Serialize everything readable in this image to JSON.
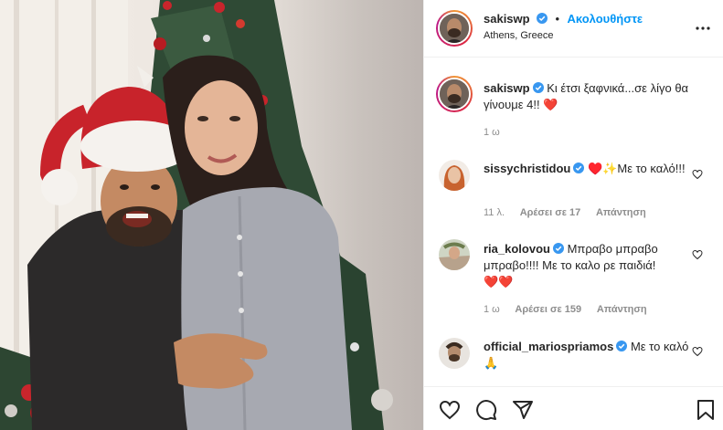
{
  "post": {
    "username": "sakiswp",
    "follow_label": "Ακολουθήστε",
    "separator": "•",
    "location": "Athens, Greece",
    "caption": "Κι έτσι ξαφνικά...σε λίγο θα γίνουμε 4!! ",
    "caption_emoji": "❤️",
    "time": "1 ω"
  },
  "comments": [
    {
      "username": "sissychristidou",
      "text": " ♥️✨Με το καλό!!!",
      "time": "11 λ.",
      "likes": "Αρέσει σε 17",
      "reply": "Απάντηση"
    },
    {
      "username": "ria_kolovou",
      "text": " Μπραβο μπραβο μπραβο!!!! Με το καλο ρε παιδιά!",
      "emoji": "❤️❤️",
      "time": "1 ω",
      "likes": "Αρέσει σε 159",
      "reply": "Απάντηση"
    },
    {
      "username": "official_mariospriamos",
      "text": " Με το καλό 🙏"
    }
  ],
  "icons": {
    "more": "more-options-icon",
    "verified": "verified-badge-icon",
    "like": "heart-outline-icon",
    "comment": "comment-icon",
    "share": "send-icon",
    "save": "bookmark-icon"
  },
  "colors": {
    "accent": "#0095f6",
    "heart": "#ed4956",
    "muted": "#8e8e8e"
  }
}
